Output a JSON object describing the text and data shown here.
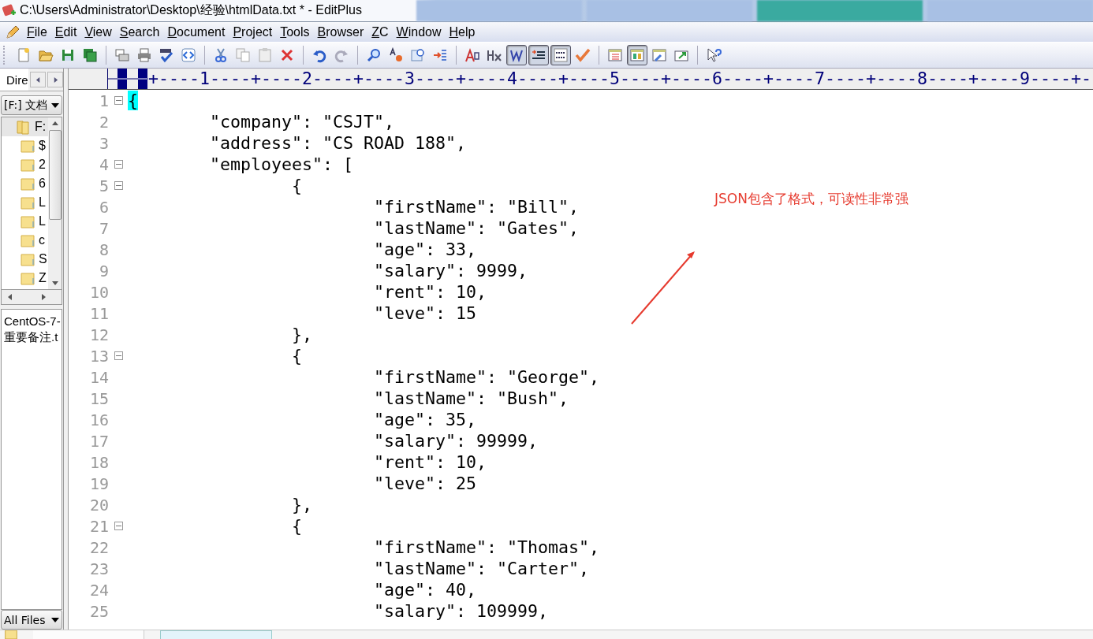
{
  "window": {
    "title": "C:\\Users\\Administrator\\Desktop\\经验\\htmlData.txt * - EditPlus"
  },
  "taskbar_tabs": [
    {
      "selected": false
    },
    {
      "selected": false
    },
    {
      "selected": true
    },
    {
      "selected": false
    }
  ],
  "menu": [
    "File",
    "Edit",
    "View",
    "Search",
    "Document",
    "Project",
    "Tools",
    "Browser",
    "ZC",
    "Window",
    "Help"
  ],
  "toolbar": [
    {
      "kind": "new",
      "pressed": false
    },
    {
      "kind": "open",
      "pressed": false
    },
    {
      "kind": "save",
      "pressed": false
    },
    {
      "kind": "save_all",
      "pressed": false
    },
    {
      "kind": "separator"
    },
    {
      "kind": "print_preview",
      "pressed": false
    },
    {
      "kind": "print",
      "pressed": false
    },
    {
      "kind": "spell",
      "pressed": false
    },
    {
      "kind": "browser",
      "pressed": false
    },
    {
      "kind": "separator"
    },
    {
      "kind": "cut",
      "pressed": false
    },
    {
      "kind": "copy",
      "pressed": false
    },
    {
      "kind": "paste",
      "pressed": false
    },
    {
      "kind": "delete",
      "pressed": false
    },
    {
      "kind": "separator"
    },
    {
      "kind": "undo",
      "pressed": false
    },
    {
      "kind": "redo",
      "pressed": false
    },
    {
      "kind": "separator"
    },
    {
      "kind": "find",
      "pressed": false
    },
    {
      "kind": "replace",
      "pressed": false
    },
    {
      "kind": "goto",
      "pressed": false
    },
    {
      "kind": "indent",
      "pressed": false
    },
    {
      "kind": "separator"
    },
    {
      "kind": "font",
      "pressed": false
    },
    {
      "kind": "hex",
      "pressed": false
    },
    {
      "kind": "wrap",
      "pressed": true
    },
    {
      "kind": "lines",
      "pressed": true
    },
    {
      "kind": "ruler",
      "pressed": true
    },
    {
      "kind": "check",
      "pressed": false
    },
    {
      "kind": "separator"
    },
    {
      "kind": "list",
      "pressed": false
    },
    {
      "kind": "layout",
      "pressed": true
    },
    {
      "kind": "tools",
      "pressed": false
    },
    {
      "kind": "window",
      "pressed": false
    },
    {
      "kind": "separator"
    },
    {
      "kind": "help",
      "pressed": false
    }
  ],
  "sidebar": {
    "tab": "Dire",
    "drive": "[F:] 文档",
    "tree": [
      {
        "label": "F:",
        "selected": true,
        "children": [
          {
            "label": "$",
            "selected": false
          },
          {
            "label": "2",
            "selected": false
          },
          {
            "label": "6",
            "selected": false
          },
          {
            "label": "L",
            "selected": false
          },
          {
            "label": "L",
            "selected": false
          },
          {
            "label": "c",
            "selected": false
          },
          {
            "label": "S",
            "selected": false
          },
          {
            "label": "Z",
            "selected": false
          }
        ]
      }
    ],
    "files": [
      "CentOS-7-",
      "重要备注.t"
    ],
    "filter": "All Files"
  },
  "ruler": "+----1----+----2----+----3----+----4----+----5----+----6----+----7----+----8----+----9----+-",
  "lines": [
    {
      "number": "1",
      "text": "{",
      "fold": true,
      "highlighted": true
    },
    {
      "number": "2",
      "text": "\t\"company\": \"CSJT\",",
      "fold": false,
      "highlighted": false
    },
    {
      "number": "3",
      "text": "\t\"address\": \"CS ROAD 188\",",
      "fold": false,
      "highlighted": false
    },
    {
      "number": "4",
      "text": "\t\"employees\": [",
      "fold": true,
      "highlighted": false
    },
    {
      "number": "5",
      "text": "\t\t{",
      "fold": true,
      "highlighted": false
    },
    {
      "number": "6",
      "text": "\t\t\t\"firstName\": \"Bill\",",
      "fold": false,
      "highlighted": false
    },
    {
      "number": "7",
      "text": "\t\t\t\"lastName\": \"Gates\",",
      "fold": false,
      "highlighted": false
    },
    {
      "number": "8",
      "text": "\t\t\t\"age\": 33,",
      "fold": false,
      "highlighted": false
    },
    {
      "number": "9",
      "text": "\t\t\t\"salary\": 9999,",
      "fold": false,
      "highlighted": false
    },
    {
      "number": "10",
      "text": "\t\t\t\"rent\": 10,",
      "fold": false,
      "highlighted": false
    },
    {
      "number": "11",
      "text": "\t\t\t\"leve\": 15",
      "fold": false,
      "highlighted": false
    },
    {
      "number": "12",
      "text": "\t\t},",
      "fold": false,
      "highlighted": false
    },
    {
      "number": "13",
      "text": "\t\t{",
      "fold": true,
      "highlighted": false
    },
    {
      "number": "14",
      "text": "\t\t\t\"firstName\": \"George\",",
      "fold": false,
      "highlighted": false
    },
    {
      "number": "15",
      "text": "\t\t\t\"lastName\": \"Bush\",",
      "fold": false,
      "highlighted": false
    },
    {
      "number": "16",
      "text": "\t\t\t\"age\": 35,",
      "fold": false,
      "highlighted": false
    },
    {
      "number": "17",
      "text": "\t\t\t\"salary\": 99999,",
      "fold": false,
      "highlighted": false
    },
    {
      "number": "18",
      "text": "\t\t\t\"rent\": 10,",
      "fold": false,
      "highlighted": false
    },
    {
      "number": "19",
      "text": "\t\t\t\"leve\": 25",
      "fold": false,
      "highlighted": false
    },
    {
      "number": "20",
      "text": "\t\t},",
      "fold": false,
      "highlighted": false
    },
    {
      "number": "21",
      "text": "\t\t{",
      "fold": true,
      "highlighted": false
    },
    {
      "number": "22",
      "text": "\t\t\t\"firstName\": \"Thomas\",",
      "fold": false,
      "highlighted": false
    },
    {
      "number": "23",
      "text": "\t\t\t\"lastName\": \"Carter\",",
      "fold": false,
      "highlighted": false
    },
    {
      "number": "24",
      "text": "\t\t\t\"age\": 40,",
      "fold": false,
      "highlighted": false
    },
    {
      "number": "25",
      "text": "\t\t\t\"salary\": 109999,",
      "fold": false,
      "highlighted": false
    }
  ],
  "annotation": {
    "text": "JSON包含了格式，可读性非常强"
  }
}
